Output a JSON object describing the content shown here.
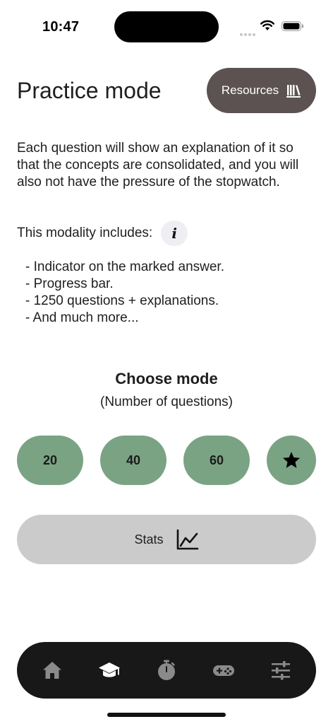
{
  "status_bar": {
    "time": "10:47"
  },
  "header": {
    "title": "Practice mode",
    "resources_label": "Resources"
  },
  "intro": {
    "description": "Each question will show an explanation of it so that the concepts are consolidated, and you will also not have the pressure of the stopwatch.",
    "includes_label": "This modality includes:",
    "info_glyph": "i",
    "features": [
      "- Indicator on the marked answer.",
      "- Progress bar.",
      "- 1250 questions + explanations.",
      "- And much more..."
    ]
  },
  "modes": {
    "title": "Choose mode",
    "subtitle": "(Number of questions)",
    "options": [
      "20",
      "40",
      "60"
    ],
    "favorites_icon": "star-icon"
  },
  "stats": {
    "label": "Stats",
    "icon": "line-chart-icon"
  },
  "tab_bar": {
    "items": [
      "home-icon",
      "graduation-cap-icon",
      "stopwatch-icon",
      "gamepad-icon",
      "sliders-icon"
    ],
    "active_index": 1
  },
  "colors": {
    "accent_green": "#7aa384",
    "resources_bg": "#5b5251",
    "stats_bg": "#cbcbcb",
    "tab_bar_bg": "#181818",
    "tab_active": "#ffffff",
    "tab_inactive": "#8a8a8a"
  }
}
